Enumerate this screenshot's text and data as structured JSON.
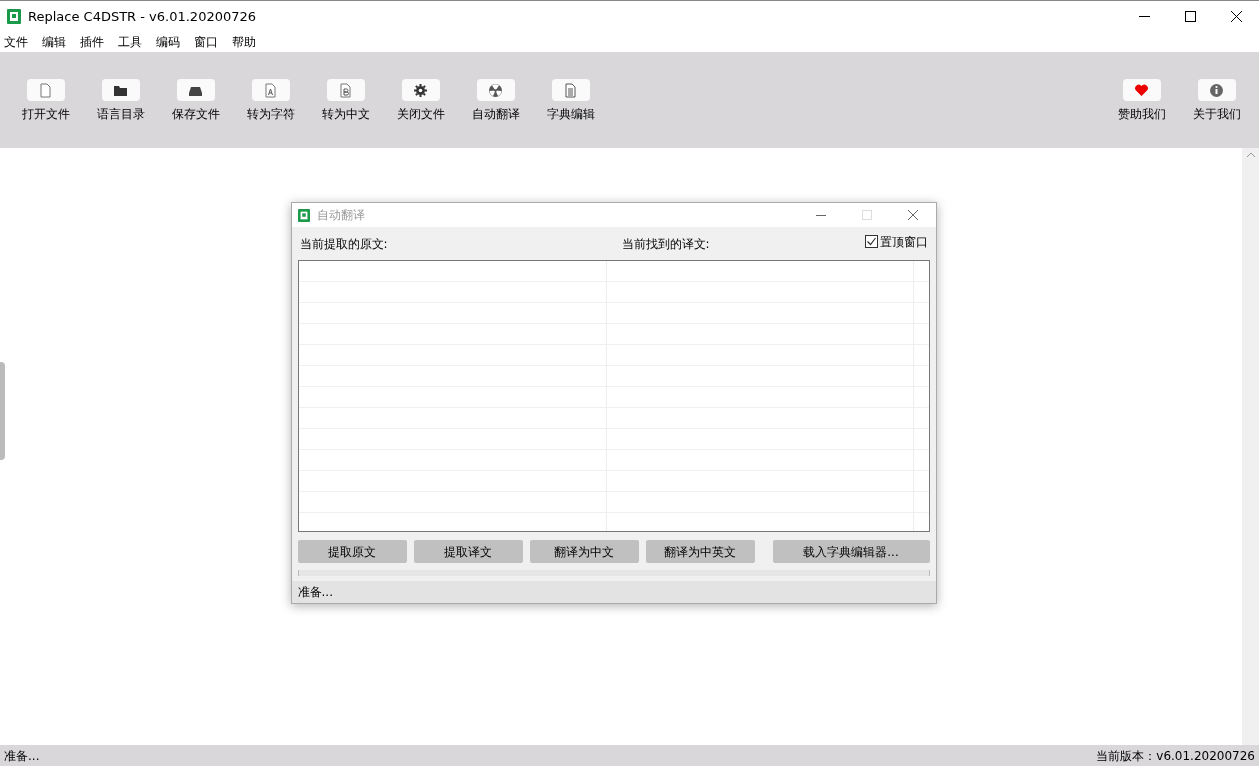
{
  "window": {
    "title": "Replace C4DSTR - v6.01.20200726"
  },
  "menu": [
    "文件",
    "编辑",
    "插件",
    "工具",
    "编码",
    "窗口",
    "帮助"
  ],
  "toolbar": [
    {
      "label": "打开文件",
      "kind": "file"
    },
    {
      "label": "语言目录",
      "kind": "folder"
    },
    {
      "label": "保存文件",
      "kind": "drive"
    },
    {
      "label": "转为字符",
      "kind": "doc-a"
    },
    {
      "label": "转为中文",
      "kind": "doc-b"
    },
    {
      "label": "关闭文件",
      "kind": "gear"
    },
    {
      "label": "自动翻译",
      "kind": "radiation"
    },
    {
      "label": "字典编辑",
      "kind": "lines"
    }
  ],
  "toolbar_right": [
    {
      "label": "赞助我们",
      "kind": "heart"
    },
    {
      "label": "关于我们",
      "kind": "info"
    }
  ],
  "dialog": {
    "title": "自动翻译",
    "source_label": "当前提取的原文:",
    "target_label": "当前找到的译文:",
    "stay_on_top": {
      "label": "置顶窗口",
      "checked": true
    },
    "buttons": [
      "提取原文",
      "提取译文",
      "翻译为中文",
      "翻译为中英文"
    ],
    "load_button": "载入字典编辑器...",
    "progress": {
      "level": 0
    },
    "status": "准备..."
  },
  "status_bar": {
    "left": "准备...",
    "right": "当前版本：v6.01.20200726"
  }
}
